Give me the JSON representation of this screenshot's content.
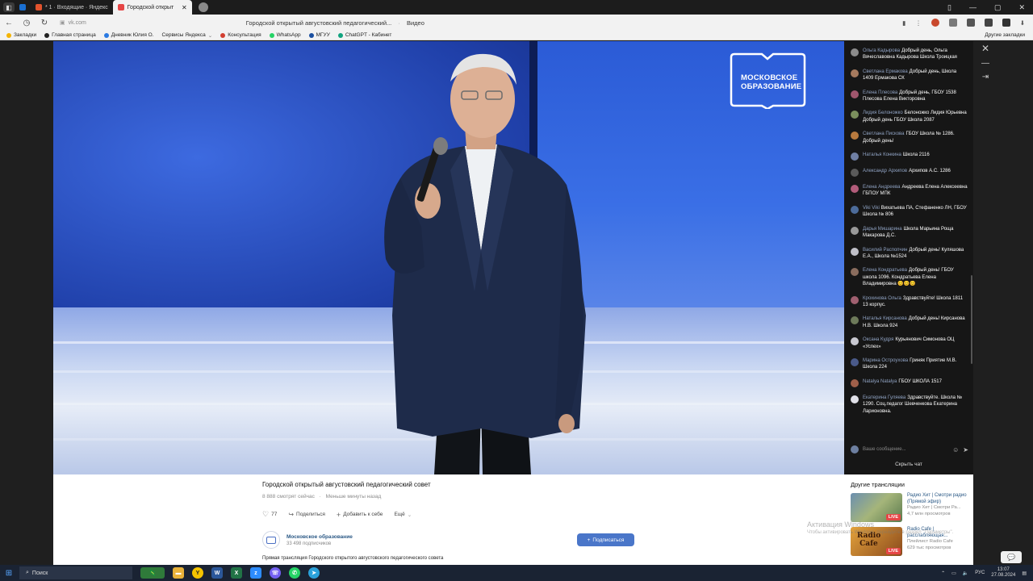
{
  "browser": {
    "tabs": [
      {
        "label": "",
        "icon": "outlook-icon"
      },
      {
        "label": "* 1 · Входящие · Яндекс",
        "icon": "mail-icon"
      },
      {
        "label": "Городской открыт",
        "icon": "vk-icon",
        "active": true
      }
    ],
    "url": "vk.com",
    "page_title": "Городской открытый августовский педагогический...",
    "page_title_suffix": "Видео",
    "bookmarks": [
      "Закладки",
      "Главная страница",
      "Дневник Юлия О.",
      "Сервисы Яндекса",
      "Консультация",
      "WhatsApp",
      "МГУУ",
      "ChatGPT - Кабинет"
    ],
    "bookmarks_right": "Другие закладки"
  },
  "video": {
    "logo_line1": "МОСКОВСКОЕ",
    "logo_line2": "ОБРАЗОВАНИЕ",
    "title": "Городской открытый августовский педагогический совет",
    "viewers": "8 888 смотрят сейчас",
    "started": "Меньше минуты назад",
    "likes": "77",
    "share_label": "Поделиться",
    "add_label": "Добавить к себе",
    "more_label": "Ещё",
    "description": "Прямая трансляция Городского открытого августовского педагогического совета"
  },
  "channel": {
    "name": "Московское образование",
    "subscribers": "33 498 подписчиков",
    "subscribe_label": "Подписаться"
  },
  "chat": {
    "messages": [
      {
        "name": "Ольга Кадырова",
        "text": "Добрый день, Ольга Вячеславовна Кадырова Школа Троицкая",
        "avatar_color": "#8c8c8c"
      },
      {
        "name": "Светлана Ермакова",
        "text": "Добрый день, Школа 1409 Ермакова СК",
        "avatar_color": "#a57a5e"
      },
      {
        "name": "Елена Плесова",
        "text": "Добрый день, ГБОУ 1538 Плесова Елена Викторовна",
        "avatar_color": "#a0566d"
      },
      {
        "name": "Лидия Белоножко",
        "text": "Белоножко Лидия Юрьевна Добрый день ГБОУ Школа 2087",
        "avatar_color": "#7b8f5d"
      },
      {
        "name": "Светлана Пискова",
        "text": "ГБОУ Школа № 1286. Добрый день!",
        "avatar_color": "#b87a3e"
      },
      {
        "name": "Наталья Конкина",
        "text": "Школа 2116",
        "avatar_color": "#6f7fa3"
      },
      {
        "name": "Александр Архипов",
        "text": "Архипов А.С. 1286",
        "avatar_color": "#5b5b5b"
      },
      {
        "name": "Елена Андреева",
        "text": "Андреева Елена Алексеевна ГБПОУ МПК",
        "avatar_color": "#b25c7a"
      },
      {
        "name": "Viki Viki",
        "text": "Вихатьева ПА, Стефаненко ЛН, ГБОУ Школа № 806",
        "avatar_color": "#4c6b9a"
      },
      {
        "name": "Дарья Мишарина",
        "text": "Школа Марьина Роща Макарова Д.С.",
        "avatar_color": "#999999"
      },
      {
        "name": "Василий Распопчин",
        "text": "Добрый день! Куляшова Е.А., Школа №1524",
        "avatar_color": "#c0c0c8"
      },
      {
        "name": "Елена Кондратьева",
        "text": "Добрый день! ГБОУ школа 1096. Кондратьева Елена Владимировна 😊😊😊",
        "avatar_color": "#8a6d5e"
      },
      {
        "name": "Крохинова Ольга",
        "text": "Здравствуйте! Школа 1811 13 корпус.",
        "avatar_color": "#a06070"
      },
      {
        "name": "Наталья Кирсанова",
        "text": "Добрый день! Кирсанова Н.В. Школа 924",
        "avatar_color": "#6d7a5a"
      },
      {
        "name": "Оксана Кудря",
        "text": "Курьянович Симонова ОЦ «Успех»",
        "avatar_color": "#c8c8d0"
      },
      {
        "name": "Марина Остроухова",
        "text": "Гриняк Приятие М.В. Школа 224",
        "avatar_color": "#4a5a8a"
      },
      {
        "name": "Natalya Natalya",
        "text": "ГБОУ ШКОЛА 1517",
        "avatar_color": "#a0604a"
      },
      {
        "name": "Екатерина Гуляева",
        "text": "Здравствуйте. Школа № 1290. Соц.педагог Шевченкова Екатерина Ларионовна.",
        "avatar_color": "#e0e0e8"
      }
    ],
    "input_placeholder": "Ваше сообщение...",
    "hide_label": "Скрыть чат"
  },
  "other": {
    "title": "Другие трансляции",
    "items": [
      {
        "title": "Радио Хит | Смотри радио (Прямой эфир)",
        "sub": "Радио Хит | Смотри Ра...",
        "views": "4,7 млн просмотров",
        "thumb_color": "#7a9fc0"
      },
      {
        "title": "Radio Cafe | расслабляющая...",
        "sub": "Плейлист Radio Cafe",
        "views": "629 тыс просмотров",
        "thumb_color": "#c8832a"
      }
    ],
    "live_label": "LIVE"
  },
  "watermark": {
    "line1": "Активация Windows",
    "line2": "Чтобы активировать Windows, перейдите в раздел \"Параметры\"."
  },
  "taskbar": {
    "search_label": "Поиск",
    "time": "13:07",
    "date": "27.08.2024",
    "lang": "РУС"
  },
  "colors": {
    "accent": "#4a76c9",
    "live": "#e64646",
    "chat_bg": "#161616"
  }
}
